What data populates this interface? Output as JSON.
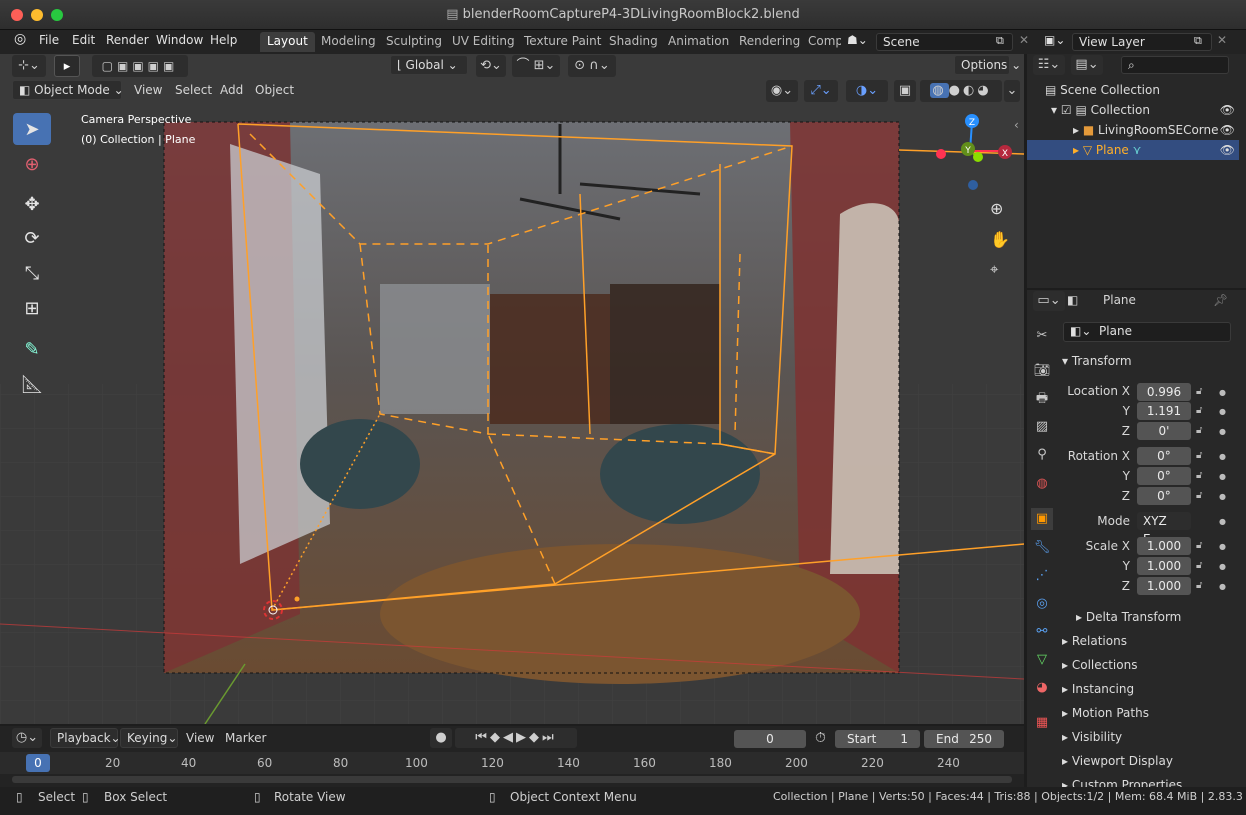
{
  "window": {
    "title": "blenderRoomCaptureP4-3DLivingRoomBlock2.blend"
  },
  "menu": [
    "File",
    "Edit",
    "Render",
    "Window",
    "Help"
  ],
  "workspaces": [
    "Layout",
    "Modeling",
    "Sculpting",
    "UV Editing",
    "Texture Paint",
    "Shading",
    "Animation",
    "Rendering",
    "Comp"
  ],
  "scene": {
    "label": "Scene",
    "view_layer": "View Layer"
  },
  "toolbar": {
    "transform": "Global",
    "options": "Options"
  },
  "header": {
    "mode": "Object Mode",
    "view": "View",
    "select": "Select",
    "add": "Add",
    "object": "Object"
  },
  "viewport": {
    "camera": "Camera Perspective",
    "collection": "(0) Collection | Plane",
    "gizmo": {
      "z": "Z",
      "y": "Y",
      "x": "X"
    }
  },
  "outliner": {
    "scene_collection": "Scene Collection",
    "collection": "Collection",
    "camera": "LivingRoomSECorne",
    "plane": "Plane"
  },
  "properties": {
    "object": "Plane",
    "data_name": "Plane",
    "transform": "Transform",
    "location_x_label": "Location X",
    "location_x": "0.996",
    "y_label": "Y",
    "location_y": "1.191",
    "z_label": "Z",
    "location_z": "0'",
    "rotation_x_label": "Rotation X",
    "rotation_x": "0°",
    "rotation_y": "0°",
    "rotation_z": "0°",
    "mode_label": "Mode",
    "mode": "XYZ E...",
    "scale_x_label": "Scale X",
    "scale_x": "1.000",
    "scale_y": "1.000",
    "scale_z": "1.000",
    "delta": "Delta Transform",
    "panels": [
      "Relations",
      "Collections",
      "Instancing",
      "Motion Paths",
      "Visibility",
      "Viewport Display",
      "Custom Properties"
    ]
  },
  "timeline": {
    "playback": "Playback",
    "keying": "Keying",
    "view": "View",
    "marker": "Marker",
    "frame": "0",
    "start_label": "Start",
    "start": "1",
    "end_label": "End",
    "end": "250",
    "current": "0",
    "ticks": [
      "20",
      "40",
      "60",
      "80",
      "100",
      "120",
      "140",
      "160",
      "180",
      "200",
      "220",
      "240"
    ]
  },
  "status": {
    "select": "Select",
    "box_select": "Box Select",
    "rotate": "Rotate View",
    "context": "Object Context Menu",
    "info": "Collection | Plane | Verts:50 | Faces:44 | Tris:88 | Objects:1/2 | Mem: 68.4 MiB | 2.83.3"
  },
  "colors": {
    "accent": "#4772b3",
    "orange": "#ffa028",
    "red": "#ff3352",
    "green": "#8bdc00",
    "blue": "#2890ff"
  }
}
